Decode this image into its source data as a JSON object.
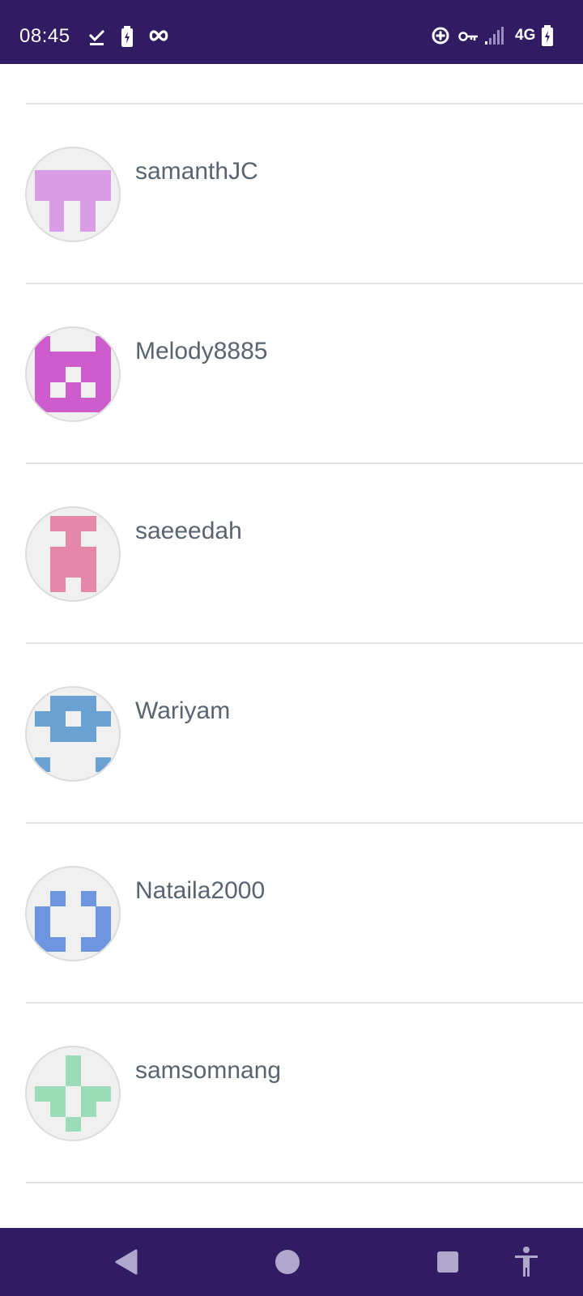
{
  "status_bar": {
    "time": "08:45",
    "network": "4G",
    "icons": [
      "download-done-icon",
      "battery-saver-icon",
      "infinity-icon",
      "data-saver-icon",
      "vpn-key-icon",
      "signal-icon",
      "battery-charging-icon"
    ]
  },
  "users": [
    {
      "username": "samanthJC",
      "avatar_color": "#d99de6"
    },
    {
      "username": "Melody8885",
      "avatar_color": "#cd5ccc"
    },
    {
      "username": "saeeedah",
      "avatar_color": "#e487a9"
    },
    {
      "username": "Wariyam",
      "avatar_color": "#6aa0d2"
    },
    {
      "username": "Nataila2000",
      "avatar_color": "#6e96e0"
    },
    {
      "username": "samsomnang",
      "avatar_color": "#9cdcb8"
    }
  ],
  "nav_bar": {
    "buttons": [
      "back-icon",
      "home-icon",
      "recents-icon",
      "accessibility-icon"
    ],
    "icon_color": "#b0a8cc"
  },
  "colors": {
    "status_bar_bg": "#311b63",
    "nav_bar_bg": "#311b63",
    "username_text": "#5a6470",
    "divider": "#e3e3e3"
  }
}
